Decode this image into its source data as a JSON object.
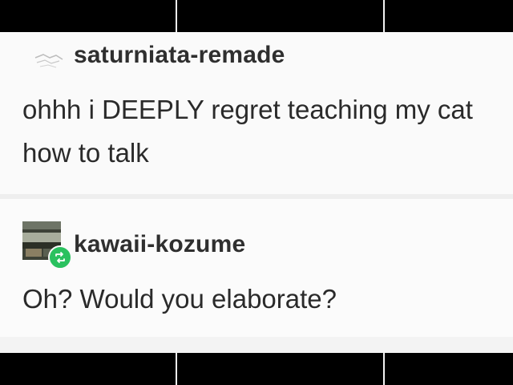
{
  "posts": [
    {
      "username": "saturniata-remade",
      "text": "ohhh i DEEPLY regret teaching my cat how to talk",
      "avatar_icon": "default-avatar-icon"
    },
    {
      "username": "kawaii-kozume",
      "text": "Oh? Would you elaborate?",
      "avatar_icon": "user-avatar-icon",
      "badge_icon": "reblog-icon",
      "badge_color": "#2ac15f"
    }
  ]
}
